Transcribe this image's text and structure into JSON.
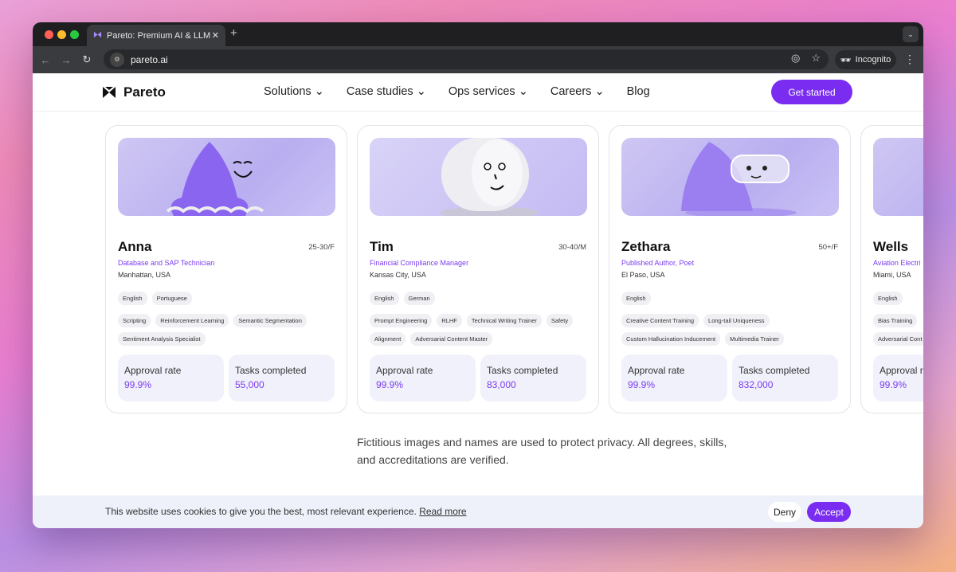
{
  "browser": {
    "tab_title": "Pareto: Premium AI & LLM Tra",
    "url": "pareto.ai",
    "incognito_label": "Incognito"
  },
  "nav": {
    "brand": "Pareto",
    "items": [
      "Solutions",
      "Case studies",
      "Ops services",
      "Careers",
      "Blog"
    ],
    "cta": "Get started"
  },
  "cards": [
    {
      "name": "Anna",
      "age": "25-30/F",
      "role": "Database and SAP Technician",
      "location": "Manhattan, USA",
      "languages": [
        "English",
        "Portuguese"
      ],
      "skills": [
        "Scripting",
        "Reinforcement Learning",
        "Semantic Segmentation",
        "Sentiment Analysis Specialist"
      ],
      "approval_label": "Approval rate",
      "approval": "99.9%",
      "tasks_label": "Tasks completed",
      "tasks": "55,000"
    },
    {
      "name": "Tim",
      "age": "30-40/M",
      "role": "Financial Compliance Manager",
      "location": "Kansas City, USA",
      "languages": [
        "English",
        "German"
      ],
      "skills": [
        "Prompt Engineering",
        "RLHF",
        "Technical Writing Trainer",
        "Safety",
        "Alignment",
        "Adversarial Content Master"
      ],
      "approval_label": "Approval rate",
      "approval": "99.9%",
      "tasks_label": "Tasks completed",
      "tasks": "83,000"
    },
    {
      "name": "Zethara",
      "age": "50+/F",
      "role": "Published Author, Poet",
      "location": "El Paso, USA",
      "languages": [
        "English"
      ],
      "skills": [
        "Creative Content Training",
        "Long-tail Uniqueness",
        "Custom Hallucination Inducement",
        "Multimedia Trainer"
      ],
      "approval_label": "Approval rate",
      "approval": "99.9%",
      "tasks_label": "Tasks completed",
      "tasks": "832,000"
    },
    {
      "name": "Wells",
      "age": "",
      "role": "Aviation Electri",
      "location": "Miami, USA",
      "languages": [
        "English"
      ],
      "skills": [
        "Bias Training",
        "Adversarial Cont"
      ],
      "approval_label": "Approval ra",
      "approval": "99.9%",
      "tasks_label": "",
      "tasks": ""
    }
  ],
  "disclaimer": "Fictitious images and names are used to protect privacy. All degrees, skills, and accreditations are verified.",
  "cookie": {
    "text": "This website uses cookies to give you the best, most relevant experience.",
    "link": "Read more",
    "deny": "Deny",
    "accept": "Accept"
  },
  "colors": {
    "accent": "#7a2df0",
    "stat_bg": "#f1f1fb"
  }
}
